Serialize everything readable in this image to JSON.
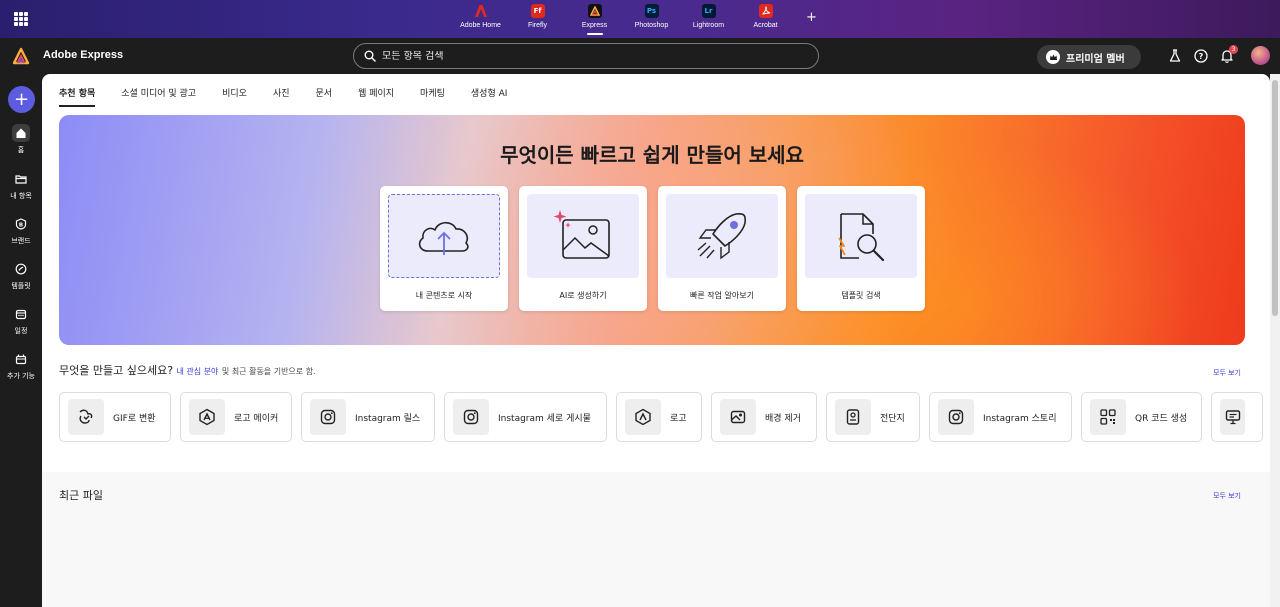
{
  "appbar": {
    "apps": [
      {
        "label": "Adobe Home",
        "logo_text": "",
        "color": "#e0281e"
      },
      {
        "label": "Firefly",
        "logo_text": "Ff",
        "color": "#e0281e"
      },
      {
        "label": "Express",
        "logo_text": "",
        "color": "#1a1a1a",
        "active": true
      },
      {
        "label": "Photoshop",
        "logo_text": "Ps",
        "color": "#001e36"
      },
      {
        "label": "Lightroom",
        "logo_text": "Lr",
        "color": "#001a33"
      },
      {
        "label": "Acrobat",
        "logo_text": "",
        "color": "#e0281e"
      }
    ]
  },
  "header": {
    "brand": "Adobe Express",
    "search_placeholder": "모든 항목 검색",
    "premium_label": "프리미엄 멤버",
    "notification_count": "3"
  },
  "rail": {
    "items": [
      {
        "label": "홈",
        "icon": "home-icon"
      },
      {
        "label": "내 항목",
        "icon": "folder-icon"
      },
      {
        "label": "브랜드",
        "icon": "brand-icon"
      },
      {
        "label": "템플릿",
        "icon": "template-icon"
      },
      {
        "label": "일정",
        "icon": "calendar-icon"
      },
      {
        "label": "추가 기능",
        "icon": "addons-icon"
      }
    ]
  },
  "tabs": [
    "추천 항목",
    "소셜 미디어 및 광고",
    "비디오",
    "사진",
    "문서",
    "웹 페이지",
    "마케팅",
    "생성형 AI"
  ],
  "hero": {
    "title": "무엇이든 빠르고 쉽게 만들어 보세요",
    "cards": [
      {
        "label": "내 콘텐츠로 시작",
        "icon": "upload-cloud-icon"
      },
      {
        "label": "AI로 생성하기",
        "icon": "ai-image-icon"
      },
      {
        "label": "빠른 작업 알아보기",
        "icon": "rocket-icon"
      },
      {
        "label": "템플릿 검색",
        "icon": "template-search-icon"
      }
    ]
  },
  "create": {
    "title": "무엇을 만들고 싶으세요?",
    "interest_link": "내 관심 분야",
    "subtitle": "및 최근 활동을 기반으로 함.",
    "view_all": "모두 보기",
    "items": [
      {
        "label": "GIF로 변환",
        "icon": "gif-icon"
      },
      {
        "label": "로고 메이커",
        "icon": "logo-maker-icon"
      },
      {
        "label": "Instagram 릴스",
        "icon": "instagram-icon"
      },
      {
        "label": "Instagram 세로 게시물",
        "icon": "instagram-icon"
      },
      {
        "label": "로고",
        "icon": "logo-icon"
      },
      {
        "label": "배경 제거",
        "icon": "remove-background-icon"
      },
      {
        "label": "전단지",
        "icon": "flyer-icon"
      },
      {
        "label": "Instagram 스토리",
        "icon": "instagram-icon"
      },
      {
        "label": "QR 코드 생성",
        "icon": "qr-code-icon"
      },
      {
        "label": "",
        "icon": "presentation-icon"
      }
    ]
  },
  "recent": {
    "title": "최근 파일",
    "view_all": "모두 보기"
  },
  "colors": {
    "accent": "#5c5ce0",
    "link": "#3b3bd6"
  }
}
